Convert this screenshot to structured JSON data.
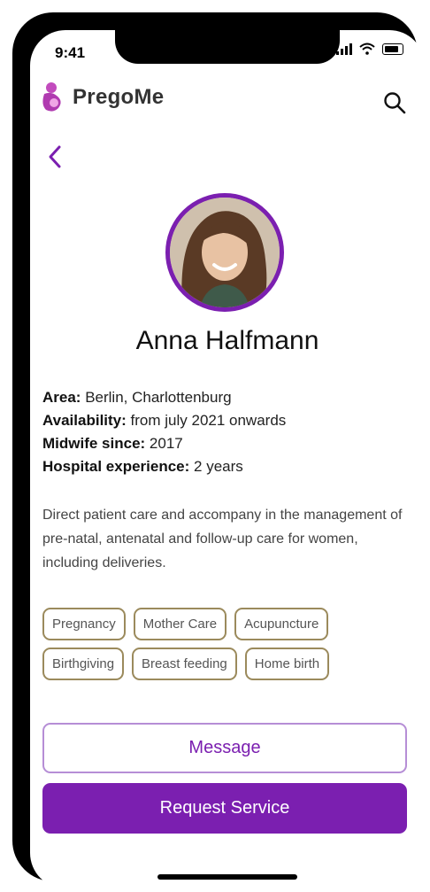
{
  "status_bar": {
    "time": "9:41"
  },
  "header": {
    "brand": "PregoMe"
  },
  "profile": {
    "name": "Anna Halfmann",
    "details": [
      {
        "label": "Area:",
        "value": "Berlin, Charlottenburg"
      },
      {
        "label": "Availability:",
        "value": "from july 2021 onwards"
      },
      {
        "label": "Midwife since:",
        "value": "2017"
      },
      {
        "label": "Hospital experience:",
        "value": "2 years"
      }
    ],
    "description": "Direct patient care and accompany in the management of pre-natal, antenatal and follow-up care for women, including deliveries.",
    "tags": [
      "Pregnancy",
      "Mother Care",
      "Acupuncture",
      "Birthgiving",
      "Breast feeding",
      "Home birth"
    ]
  },
  "actions": {
    "message_label": "Message",
    "request_label": "Request Service"
  },
  "colors": {
    "accent": "#7b1fb0",
    "tag_border": "#9b8a5c"
  }
}
